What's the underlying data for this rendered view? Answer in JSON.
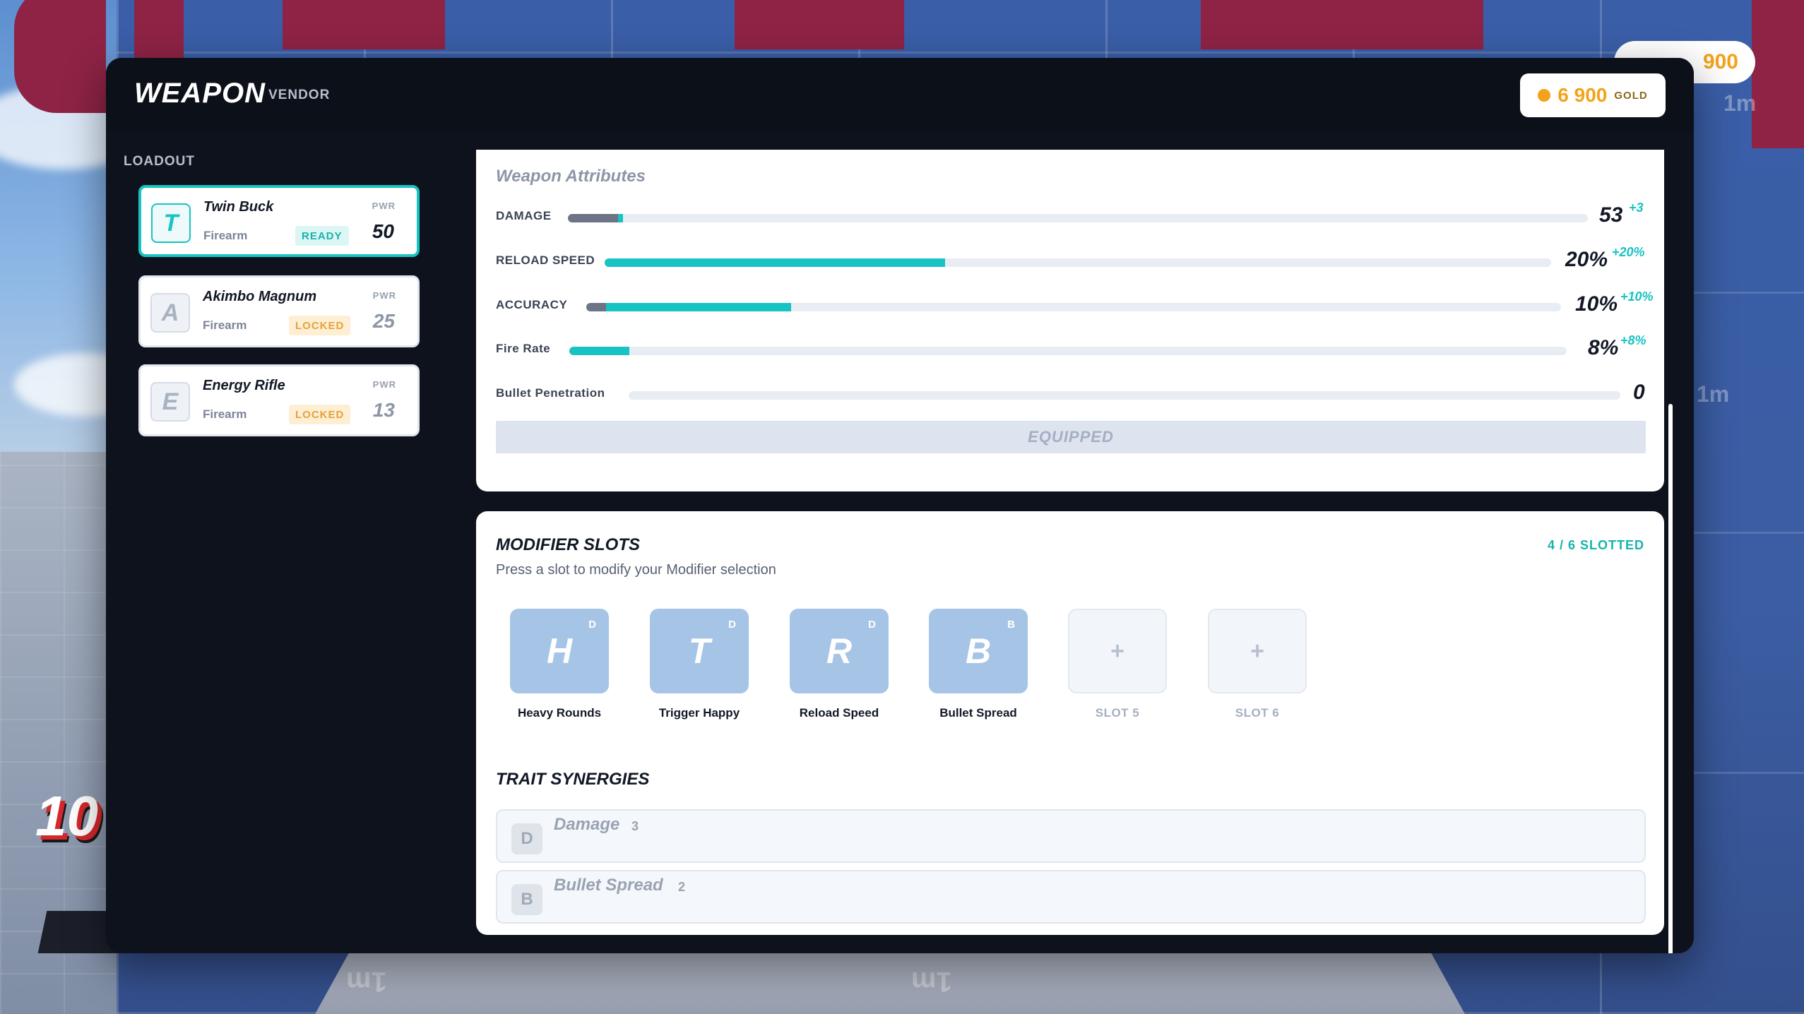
{
  "header": {
    "title": "WEAPON",
    "subtitle": "VENDOR",
    "gold_amount": "6 900",
    "gold_unit": "GOLD"
  },
  "background": {
    "floating_gold": "900",
    "grid_label": "1m",
    "score_fragment": "10"
  },
  "sidebar": {
    "section_label": "LOADOUT",
    "weapons": [
      {
        "icon": "T",
        "name": "Twin Buck",
        "type": "Firearm",
        "status": "READY",
        "pwr_label": "PWR",
        "power": "50"
      },
      {
        "icon": "A",
        "name": "Akimbo Magnum",
        "type": "Firearm",
        "status": "LOCKED",
        "pwr_label": "PWR",
        "power": "25"
      },
      {
        "icon": "E",
        "name": "Energy Rifle",
        "type": "Firearm",
        "status": "LOCKED",
        "pwr_label": "PWR",
        "power": "13"
      }
    ]
  },
  "attributes": {
    "title": "Weapon Attributes",
    "rows": [
      {
        "label": "DAMAGE",
        "value": "53",
        "bonus": "+3",
        "base_fill": 0.049,
        "bonus_fill": 0.005
      },
      {
        "label": "RELOAD SPEED",
        "value": "20%",
        "bonus": "+20%",
        "base_fill": 0.0,
        "bonus_fill": 0.36
      },
      {
        "label": "ACCURACY",
        "value": "10%",
        "bonus": "+10%",
        "base_fill": 0.02,
        "bonus_fill": 0.19
      },
      {
        "label": "Fire Rate",
        "value": "8%",
        "bonus": "+8%",
        "base_fill": 0.0,
        "bonus_fill": 0.06
      },
      {
        "label": "Bullet Penetration",
        "value": "0",
        "bonus": "",
        "base_fill": 0.0,
        "bonus_fill": 0.0
      }
    ],
    "equip_button": "EQUIPPED"
  },
  "modifiers": {
    "title": "MODIFIER SLOTS",
    "count": "4 / 6 SLOTTED",
    "hint": "Press a slot to modify your Modifier selection",
    "slots": [
      {
        "letter": "H",
        "tag": "D",
        "name": "Heavy Rounds"
      },
      {
        "letter": "T",
        "tag": "D",
        "name": "Trigger Happy"
      },
      {
        "letter": "R",
        "tag": "D",
        "name": "Reload Speed"
      },
      {
        "letter": "B",
        "tag": "B",
        "name": "Bullet Spread"
      },
      {
        "letter": "+",
        "tag": "",
        "name": "SLOT 5"
      },
      {
        "letter": "+",
        "tag": "",
        "name": "SLOT 6"
      }
    ]
  },
  "synergies": {
    "title": "TRAIT SYNERGIES",
    "rows": [
      {
        "icon": "D",
        "name": "Damage",
        "count": "3"
      },
      {
        "icon": "B",
        "name": "Bullet Spread",
        "count": "2"
      }
    ]
  }
}
